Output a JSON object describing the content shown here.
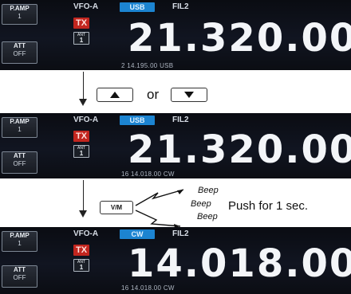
{
  "panel1": {
    "pamp_label": "P.AMP",
    "pamp_value": "1",
    "att_label": "ATT",
    "att_value": "OFF",
    "vfo": "VFO-A",
    "mode": "USB",
    "filter": "FIL2",
    "tx": "TX",
    "ant_label": "ANT",
    "ant_num": "1",
    "frequency": "21.320.00",
    "sub": "2  14.195.00  USB"
  },
  "arrow_keys": {
    "up_icon": "up-arrow-icon",
    "or_text": "or",
    "down_icon": "down-arrow-icon"
  },
  "panel2": {
    "pamp_label": "P.AMP",
    "pamp_value": "1",
    "att_label": "ATT",
    "att_value": "OFF",
    "vfo": "VFO-A",
    "mode": "USB",
    "filter": "FIL2",
    "tx": "TX",
    "ant_label": "ANT",
    "ant_num": "1",
    "frequency": "21.320.00",
    "sub": "16  14.018.00  CW"
  },
  "vm_step": {
    "key_label": "V/M",
    "beep1": "Beep",
    "beep2": "Beep",
    "beep3": "Beep",
    "instruction": "Push for 1 sec."
  },
  "panel3": {
    "pamp_label": "P.AMP",
    "pamp_value": "1",
    "att_label": "ATT",
    "att_value": "OFF",
    "vfo": "VFO-A",
    "mode": "CW",
    "filter": "FIL2",
    "tx": "TX",
    "ant_label": "ANT",
    "ant_num": "1",
    "frequency": "14.018.00",
    "sub": "16  14.018.00  CW"
  },
  "colors": {
    "mode_chip": "#1c84d1",
    "tx": "#c2261f",
    "panel_bg": "#0f121a"
  }
}
